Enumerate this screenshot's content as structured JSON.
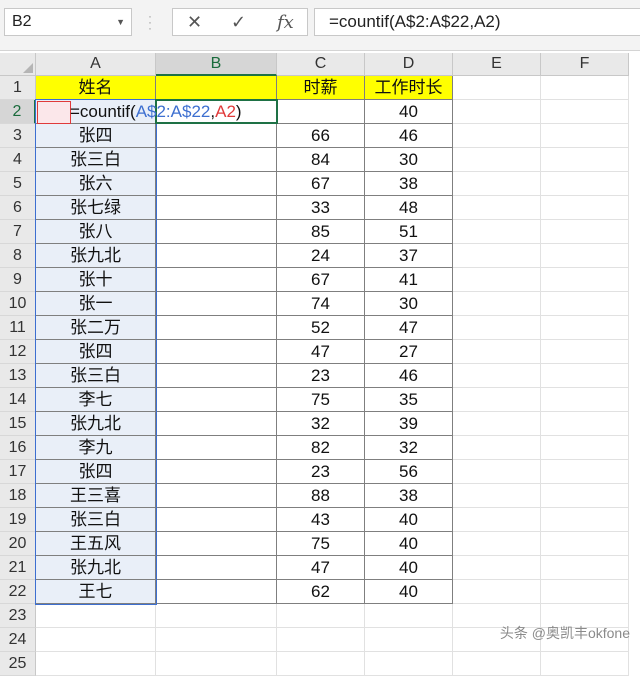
{
  "toolbar": {
    "name_box": "B2",
    "formula": "=countif(A$2:A$22,A2)"
  },
  "columns": [
    "A",
    "B",
    "C",
    "D",
    "E",
    "F"
  ],
  "rows": [
    "1",
    "2",
    "3",
    "4",
    "5",
    "6",
    "7",
    "8",
    "9",
    "10",
    "11",
    "12",
    "13",
    "14",
    "15",
    "16",
    "17",
    "18",
    "19",
    "20",
    "21",
    "22",
    "23",
    "24",
    "25"
  ],
  "headers": {
    "name": "姓名",
    "hourly": "时薪",
    "duration": "工作时长"
  },
  "editing": {
    "prefix": "=countif(",
    "ref1": "A$2:A$22",
    "sep": ",",
    "ref2": "A2",
    "suffix": ")"
  },
  "table": [
    {
      "name": "",
      "hourly": "",
      "duration": "40"
    },
    {
      "name": "张四",
      "hourly": "66",
      "duration": "46"
    },
    {
      "name": "张三白",
      "hourly": "84",
      "duration": "30"
    },
    {
      "name": "张六",
      "hourly": "67",
      "duration": "38"
    },
    {
      "name": "张七绿",
      "hourly": "33",
      "duration": "48"
    },
    {
      "name": "张八",
      "hourly": "85",
      "duration": "51"
    },
    {
      "name": "张九北",
      "hourly": "24",
      "duration": "37"
    },
    {
      "name": "张十",
      "hourly": "67",
      "duration": "41"
    },
    {
      "name": "张一",
      "hourly": "74",
      "duration": "30"
    },
    {
      "name": "张二万",
      "hourly": "52",
      "duration": "47"
    },
    {
      "name": "张四",
      "hourly": "47",
      "duration": "27"
    },
    {
      "name": "张三白",
      "hourly": "23",
      "duration": "46"
    },
    {
      "name": "李七",
      "hourly": "75",
      "duration": "35"
    },
    {
      "name": "张九北",
      "hourly": "32",
      "duration": "39"
    },
    {
      "name": "李九",
      "hourly": "82",
      "duration": "32"
    },
    {
      "name": "张四",
      "hourly": "23",
      "duration": "56"
    },
    {
      "name": "王三喜",
      "hourly": "88",
      "duration": "38"
    },
    {
      "name": "张三白",
      "hourly": "43",
      "duration": "40"
    },
    {
      "name": "王五风",
      "hourly": "75",
      "duration": "40"
    },
    {
      "name": "张九北",
      "hourly": "47",
      "duration": "40"
    },
    {
      "name": "王七",
      "hourly": "62",
      "duration": "40"
    }
  ],
  "watermark": "头条 @奥凯丰okfone"
}
